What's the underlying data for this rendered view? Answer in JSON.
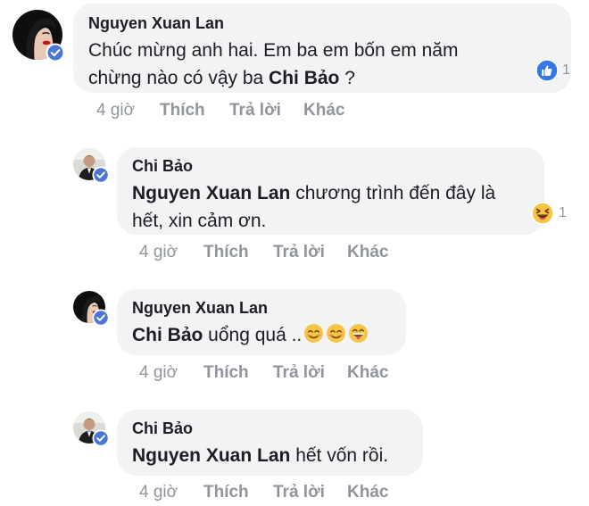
{
  "comments": [
    {
      "author": "Nguyen Xuan Lan",
      "text_line1": "Chúc mừng anh hai. Em ba em bốn em năm",
      "text_line2_prefix": "chừng nào có vậy ba ",
      "text_line2_mention": "Chi Bảo",
      "text_line2_suffix": " ?",
      "time": "4 giờ",
      "like": "Thích",
      "reply": "Trả lời",
      "more": "Khác",
      "reaction_count": "1",
      "reaction_icon": "like-icon"
    },
    {
      "author": "Chi Bảo",
      "mention": "Nguyen Xuan Lan",
      "text_line1_suffix": " chương trình đến đây là",
      "text_line2": "hết, xin cảm ơn.",
      "time": "4 giờ",
      "like": "Thích",
      "reply": "Trả lời",
      "more": "Khác",
      "reaction_count": "1",
      "reaction_icon": "laughing-icon"
    },
    {
      "author": "Nguyen Xuan Lan",
      "mention": "Chi Bảo",
      "text_suffix": " uổng quá ..",
      "emojis": [
        "smiling-face-icon",
        "smiling-face-icon",
        "grinning-tongue-face-icon"
      ],
      "time": "4 giờ",
      "like": "Thích",
      "reply": "Trả lời",
      "more": "Khác"
    },
    {
      "author": "Chi Bảo",
      "mention": "Nguyen Xuan Lan",
      "text_suffix": " hết vốn rồi.",
      "time": "4 giờ",
      "like": "Thích",
      "reply": "Trả lời",
      "more": "Khác"
    }
  ],
  "colors": {
    "bubble": "#f2f3f5",
    "meta_text": "#90949c",
    "verified_badge": "#4a76d6",
    "like_blue": "#3578e5",
    "emoji_yellow": "#f7c544"
  }
}
